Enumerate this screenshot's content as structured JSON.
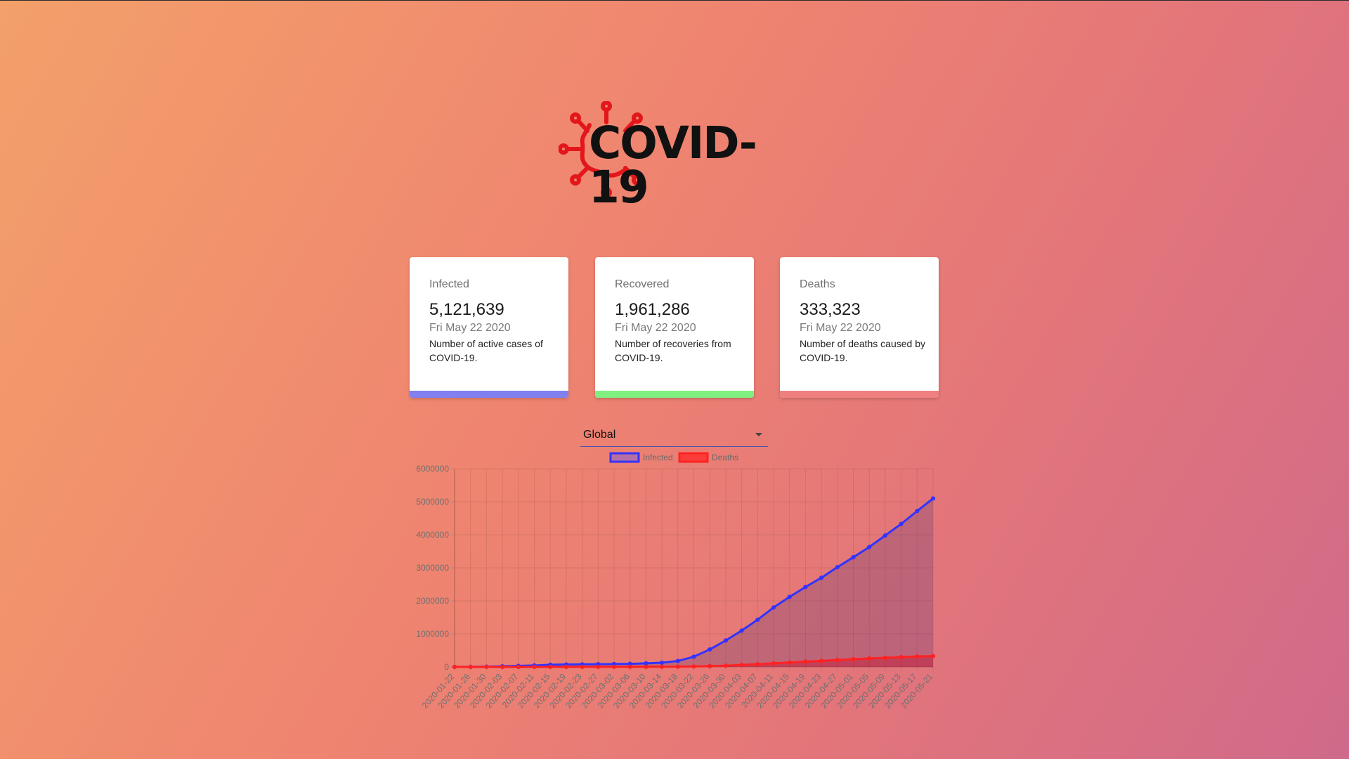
{
  "page": {
    "logo_text": "COVID-19",
    "logo_color": "#e3161b"
  },
  "cards": [
    {
      "title": "Infected",
      "value": "5,121,639",
      "date": "Fri May 22 2020",
      "description": "Number of active cases of COVID-19.",
      "accent": "#8080f0"
    },
    {
      "title": "Recovered",
      "value": "1,961,286",
      "date": "Fri May 22 2020",
      "description": "Number of recoveries from COVID-19.",
      "accent": "#80f080"
    },
    {
      "title": "Deaths",
      "value": "333,323",
      "date": "Fri May 22 2020",
      "description": "Number of deaths caused by COVID-19.",
      "accent": "#f08080"
    }
  ],
  "country_picker": {
    "selected": "Global"
  },
  "chart_data": {
    "type": "line",
    "title": "",
    "xlabel": "",
    "ylabel": "",
    "ylim": [
      0,
      6000000
    ],
    "y_ticks": [
      "0",
      "1000000",
      "2000000",
      "3000000",
      "4000000",
      "5000000",
      "6000000"
    ],
    "x_tick_labels": [
      "2020-01-22",
      "2020-01-26",
      "2020-01-30",
      "2020-02-03",
      "2020-02-07",
      "2020-02-11",
      "2020-02-15",
      "2020-02-19",
      "2020-02-23",
      "2020-02-27",
      "2020-03-02",
      "2020-03-06",
      "2020-03-10",
      "2020-03-14",
      "2020-03-18",
      "2020-03-22",
      "2020-03-26",
      "2020-03-30",
      "2020-04-03",
      "2020-04-07",
      "2020-04-11",
      "2020-04-15",
      "2020-04-19",
      "2020-04-23",
      "2020-04-27",
      "2020-05-01",
      "2020-05-05",
      "2020-05-09",
      "2020-05-13",
      "2020-05-17",
      "2020-05-21"
    ],
    "legend_position": "top",
    "grid": true,
    "series": [
      {
        "name": "Infected",
        "color": "#3333ff",
        "values": [
          555,
          2118,
          7783,
          19881,
          31481,
          44802,
          66885,
          75641,
          78985,
          83111,
          88585,
          94200,
          108000,
          128000,
          180000,
          310000,
          530000,
          800000,
          1100000,
          1430000,
          1800000,
          2120000,
          2420000,
          2700000,
          3020000,
          3320000,
          3630000,
          3980000,
          4330000,
          4720000,
          5100000
        ]
      },
      {
        "name": "Deaths",
        "color": "#ff2222",
        "values": [
          17,
          56,
          171,
          425,
          719,
          1113,
          1526,
          2122,
          2470,
          2870,
          3200,
          3460,
          4260,
          5800,
          8700,
          15000,
          24000,
          38000,
          60000,
          82000,
          108000,
          132000,
          160000,
          183000,
          209000,
          233000,
          258000,
          276000,
          297000,
          316000,
          330000
        ]
      }
    ]
  }
}
